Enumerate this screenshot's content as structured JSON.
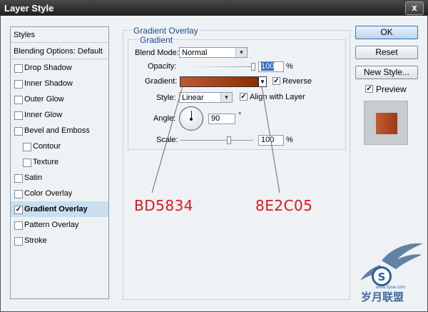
{
  "window": {
    "title": "Layer Style",
    "close_glyph": "x"
  },
  "left_list": {
    "header": "Styles",
    "blending": "Blending Options: Default",
    "items": [
      {
        "label": "Drop Shadow",
        "checked": false
      },
      {
        "label": "Inner Shadow",
        "checked": false
      },
      {
        "label": "Outer Glow",
        "checked": false
      },
      {
        "label": "Inner Glow",
        "checked": false
      },
      {
        "label": "Bevel and Emboss",
        "checked": false
      },
      {
        "label": "Contour",
        "checked": false
      },
      {
        "label": "Texture",
        "checked": false
      },
      {
        "label": "Satin",
        "checked": false
      },
      {
        "label": "Color Overlay",
        "checked": false
      },
      {
        "label": "Gradient Overlay",
        "checked": true
      },
      {
        "label": "Pattern Overlay",
        "checked": false
      },
      {
        "label": "Stroke",
        "checked": false
      }
    ]
  },
  "panel": {
    "group_title": "Gradient Overlay",
    "subgroup_title": "Gradient",
    "blend_mode": {
      "label": "Blend Mode:",
      "value": "Normal"
    },
    "opacity": {
      "label": "Opacity:",
      "value": "100",
      "unit": "%",
      "percent": 100
    },
    "gradient": {
      "label": "Gradient:",
      "color_start": "#BD5834",
      "color_end": "#8E2C05"
    },
    "reverse": {
      "label": "Reverse",
      "checked": true
    },
    "style": {
      "label": "Style:",
      "value": "Linear"
    },
    "align": {
      "label": "Align with Layer",
      "checked": true
    },
    "angle": {
      "label": "Angle:",
      "value": "90",
      "unit": "°"
    },
    "scale": {
      "label": "Scale:",
      "value": "100",
      "unit": "%",
      "percent": 100
    }
  },
  "buttons": {
    "ok": "OK",
    "reset": "Reset",
    "new_style": "New Style...",
    "preview": "Preview",
    "preview_checked": true
  },
  "annotations": {
    "left_hex": "BD5834",
    "right_hex": "8E2C05"
  },
  "watermark": {
    "text": "岁月联盟",
    "url": "www.Syue.com"
  }
}
